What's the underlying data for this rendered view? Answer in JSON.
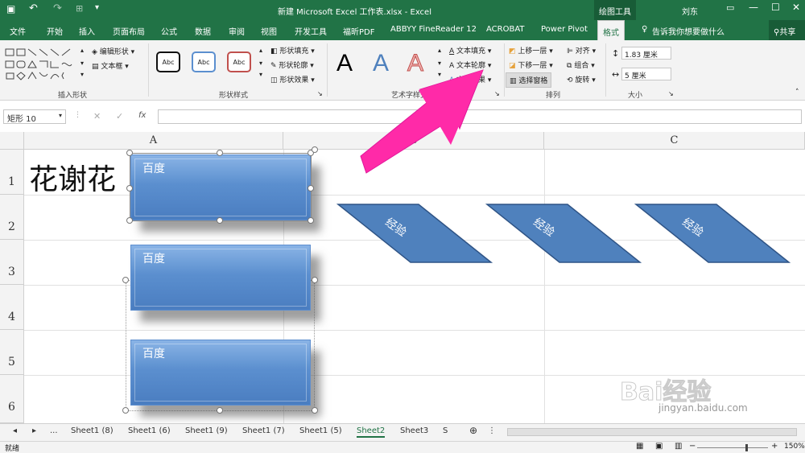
{
  "titlebar": {
    "title": "新建 Microsoft Excel 工作表.xlsx  -  Excel",
    "context_tools": "绘图工具",
    "user": "刘东"
  },
  "tabs": [
    "文件",
    "开始",
    "插入",
    "页面布局",
    "公式",
    "数据",
    "审阅",
    "视图",
    "开发工具",
    "福昕PDF",
    "ABBYY FineReader 12",
    "ACROBAT",
    "Power Pivot",
    "格式"
  ],
  "active_tab": "格式",
  "tell_me": "告诉我你想要做什么",
  "share": "共享",
  "ribbon": {
    "insert_shapes": {
      "edit_shape": "编辑形状",
      "text_box": "文本框",
      "label": "插入形状"
    },
    "shape_styles": {
      "sample": "Abc",
      "fill": "形状填充",
      "outline": "形状轮廓",
      "effects": "形状效果",
      "label": "形状样式"
    },
    "wordart": {
      "glyph": "A",
      "text_fill": "文本填充",
      "text_outline": "文本轮廓",
      "text_effects": "文本效果",
      "label": "艺术字样式"
    },
    "arrange": {
      "bring_forward": "上移一层",
      "send_backward": "下移一层",
      "selection_pane": "选择窗格",
      "align": "对齐",
      "group": "组合",
      "rotate": "旋转",
      "label": "排列"
    },
    "size": {
      "height": "1.83 厘米",
      "width": "5 厘米",
      "label": "大小"
    }
  },
  "formula": {
    "name_box": "矩形 10",
    "cancel": "✕",
    "enter": "✓",
    "fx": "fx",
    "content": ""
  },
  "grid": {
    "columns": [
      "A",
      "B",
      "C"
    ],
    "rows": [
      "1",
      "2",
      "3",
      "4",
      "5",
      "6"
    ],
    "cell_a1": "花谢花",
    "rect_label": "百度",
    "para_label": "经验"
  },
  "sheets": [
    "...",
    "Sheet1 (8)",
    "Sheet1 (6)",
    "Sheet1 (9)",
    "Sheet1 (7)",
    "Sheet1 (5)",
    "Sheet2",
    "Sheet3",
    "S"
  ],
  "active_sheet": "Sheet2",
  "status": {
    "mode": "就绪",
    "zoom": "150%"
  },
  "watermark": {
    "brand": "Bai经验",
    "url": "jingyan.baidu.com"
  },
  "colors": {
    "excel_green": "#217346",
    "arrow": "#ff2aa8",
    "shape_blue": "#4f81bd"
  }
}
